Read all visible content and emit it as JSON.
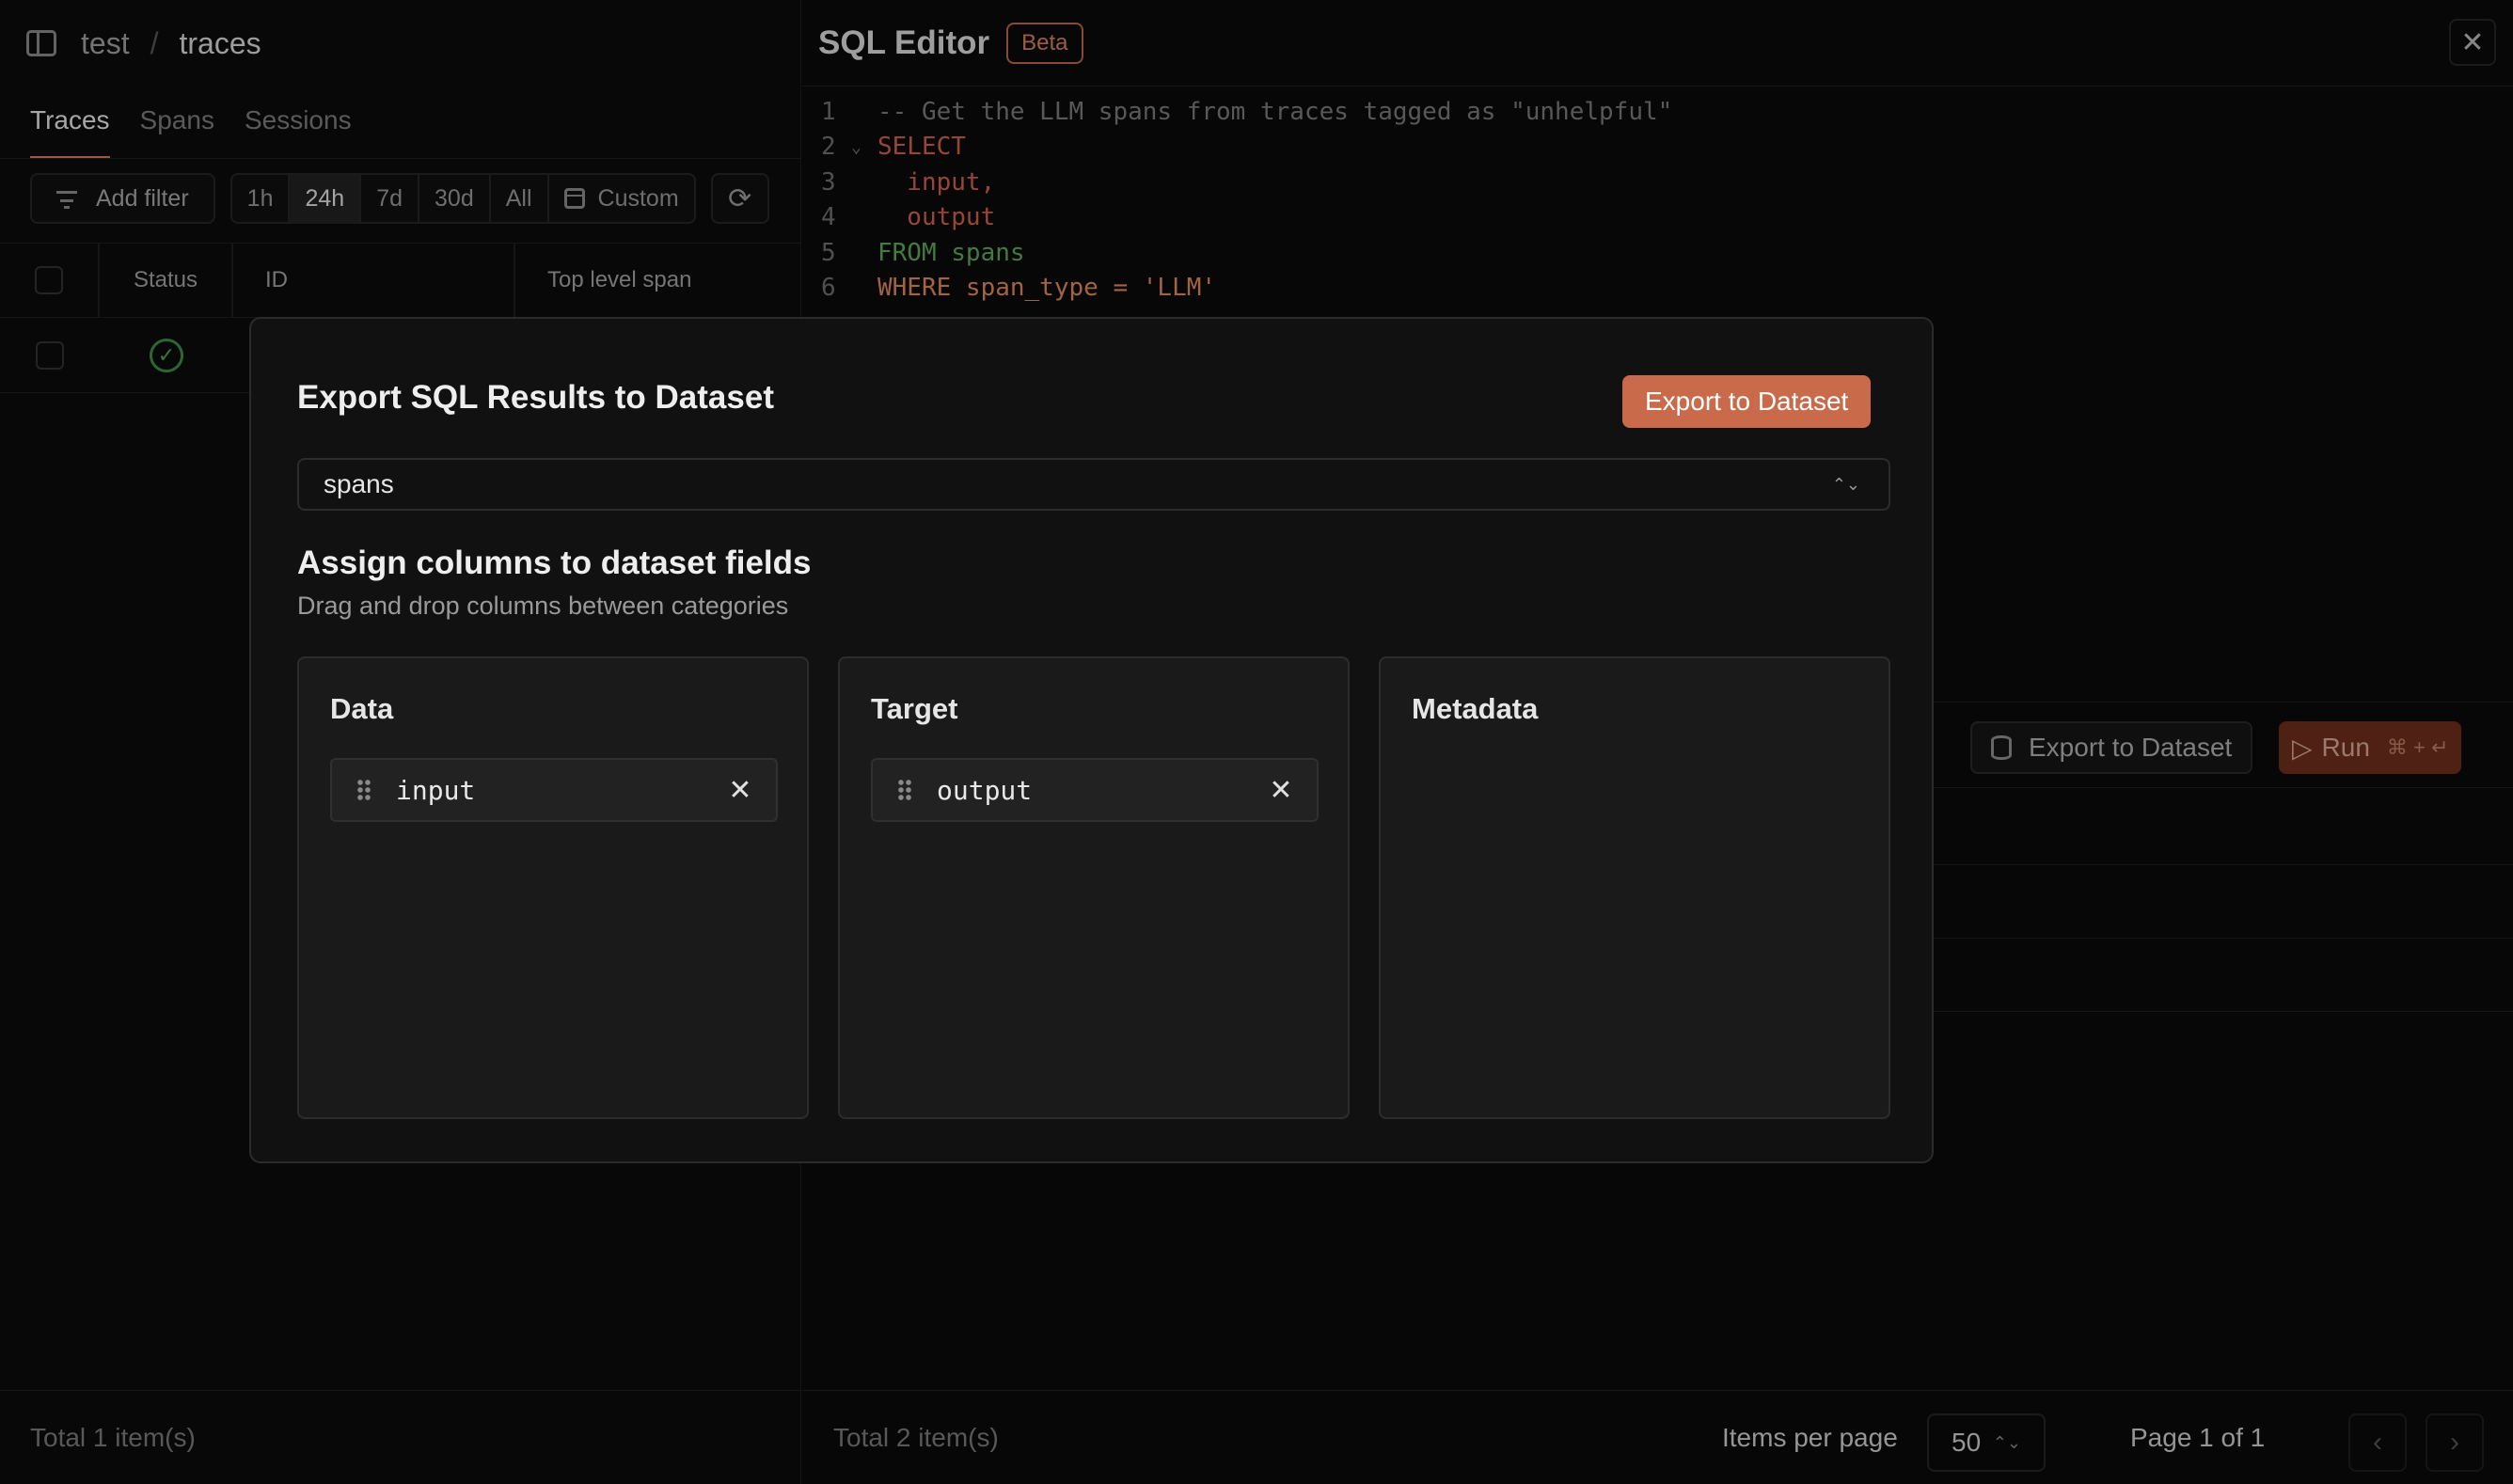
{
  "left_panel": {
    "breadcrumb": {
      "project": "test",
      "separator": "/",
      "page": "traces"
    },
    "tabs": [
      {
        "label": "Traces",
        "active": true
      },
      {
        "label": "Spans",
        "active": false
      },
      {
        "label": "Sessions",
        "active": false
      }
    ],
    "filter": {
      "add_filter_label": "Add filter",
      "ranges": [
        "1h",
        "24h",
        "7d",
        "30d",
        "All"
      ],
      "selected_range": "24h",
      "custom_label": "Custom"
    },
    "table": {
      "columns": [
        "Status",
        "ID",
        "Top level span"
      ],
      "rows": [
        {
          "status": "success"
        }
      ]
    },
    "footer_total": "Total 1 item(s)"
  },
  "sql_editor": {
    "title": "SQL Editor",
    "badge": "Beta",
    "code_lines": [
      {
        "n": "1",
        "text": "-- Get the LLM spans from traces tagged as \"unhelpful\""
      },
      {
        "n": "2",
        "text": "SELECT"
      },
      {
        "n": "3",
        "text": "  input,"
      },
      {
        "n": "4",
        "text": "  output"
      },
      {
        "n": "5",
        "text": "FROM spans"
      },
      {
        "n": "6",
        "text": "WHERE span_type = 'LLM'"
      }
    ],
    "export_button": "Export to Dataset",
    "run_button": "Run",
    "run_shortcut": "⌘ + ↵",
    "footer_total": "Total 2 item(s)",
    "items_per_page_label": "Items per page",
    "items_per_page": "50",
    "page_label": "Page 1 of 1"
  },
  "modal": {
    "title": "Export SQL Results to Dataset",
    "export_button": "Export to Dataset",
    "dataset_select": "spans",
    "section_title": "Assign columns to dataset fields",
    "section_hint": "Drag and drop columns between categories",
    "categories": [
      {
        "title": "Data",
        "columns": [
          "input"
        ]
      },
      {
        "title": "Target",
        "columns": [
          "output"
        ]
      },
      {
        "title": "Metadata",
        "columns": []
      }
    ]
  },
  "colors": {
    "accent": "#c96b4b",
    "success": "#3f8c4a",
    "background": "#0b0b0b"
  }
}
